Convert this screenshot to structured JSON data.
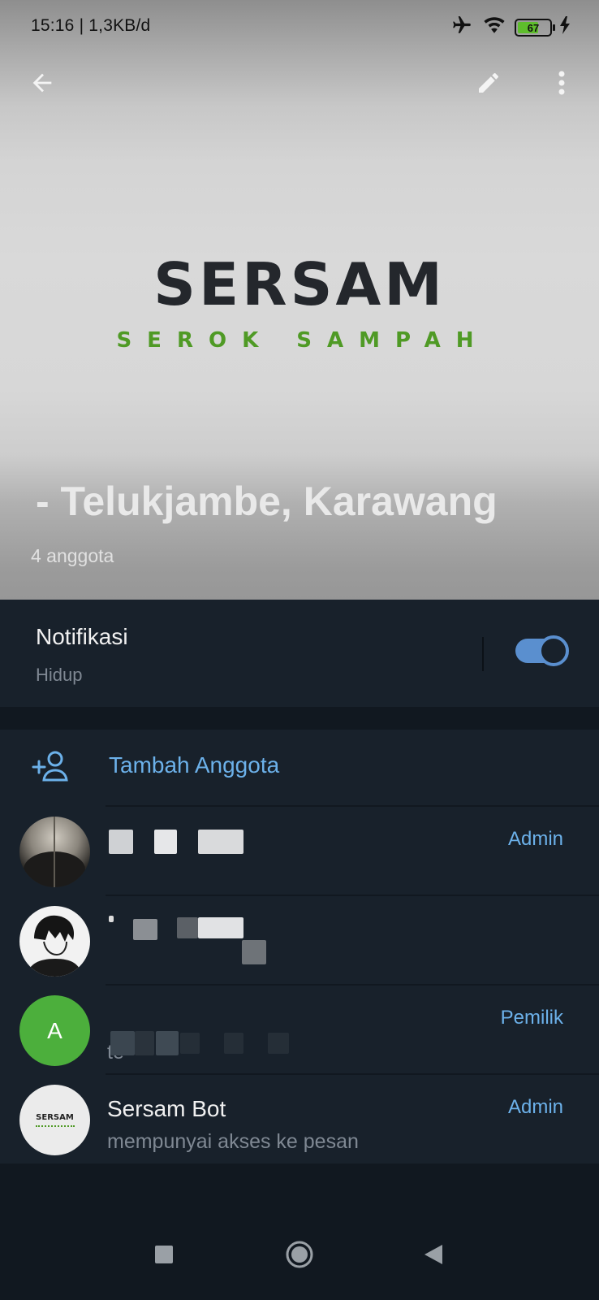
{
  "status_bar": {
    "time_speed": "15:16 | 1,3KB/d",
    "battery_level": "67",
    "icons": [
      "airplane-icon",
      "wifi-icon",
      "battery-icon",
      "charging-icon"
    ]
  },
  "header": {
    "actions": [
      "back-arrow-icon",
      "pencil-icon",
      "more-vertical-icon"
    ],
    "logo_title": "SERSAM",
    "logo_subtitle": "SEROK SAMPAH",
    "group_name": "- Telukjambe, Karawang",
    "member_count": "4 anggota"
  },
  "notifications": {
    "title": "Notifikasi",
    "status": "Hidup",
    "enabled": true
  },
  "members": {
    "add_label": "Tambah Anggota",
    "list": [
      {
        "name": "",
        "subtitle": "",
        "role": "Admin",
        "avatar": "photo"
      },
      {
        "name": "",
        "subtitle": "",
        "role": "",
        "avatar": "drawing"
      },
      {
        "name": "",
        "subtitle": "te",
        "role": "Pemilik",
        "avatar_letter": "A"
      },
      {
        "name": "Sersam Bot",
        "subtitle": "mempunyai akses ke pesan",
        "role": "Admin",
        "avatar_text": "SERSAM"
      }
    ]
  },
  "colors": {
    "accent": "#6cb1ea",
    "panel": "#18212b",
    "background": "#111820",
    "logo_green": "#4f9a25",
    "avatar_green": "#4caf3c"
  },
  "navbar": {
    "buttons": [
      "recents-square-icon",
      "home-circle-icon",
      "back-triangle-icon"
    ]
  }
}
